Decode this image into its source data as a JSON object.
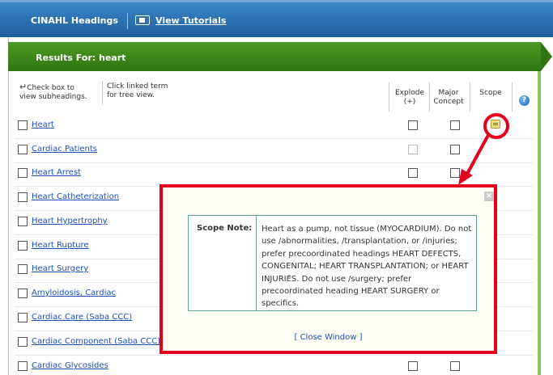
{
  "header": {
    "title": "CINAHL Headings",
    "tutorial_label": "View Tutorials"
  },
  "results": {
    "label": "Results For: heart"
  },
  "hints": {
    "checkbox_hint_line1": "Check box to",
    "checkbox_hint_line2": "view subheadings.",
    "tree_hint_line1": "Click linked term",
    "tree_hint_line2": "for tree view."
  },
  "columns": {
    "explode_line1": "Explode",
    "explode_line2": "(+)",
    "major_line1": "Major",
    "major_line2": "Concept",
    "scope": "Scope",
    "help": "?"
  },
  "terms": [
    {
      "label": "Heart",
      "explode": "enabled",
      "major": true,
      "scope": true
    },
    {
      "label": "Cardiac Patients",
      "explode": "disabled",
      "major": true,
      "scope": false
    },
    {
      "label": "Heart Arrest",
      "explode": "enabled",
      "major": true,
      "scope": false
    },
    {
      "label": "Heart Catheterization"
    },
    {
      "label": "Heart Hypertrophy"
    },
    {
      "label": "Heart Rupture"
    },
    {
      "label": "Heart Surgery"
    },
    {
      "label": "Amyloidosis, Cardiac"
    },
    {
      "label": "Cardiac Care (Saba CCC)"
    },
    {
      "label": "Cardiac Component (Saba CCC)"
    },
    {
      "label": "Cardiac Glycosides",
      "explode": "enabled",
      "major": true,
      "scope": false
    }
  ],
  "scope_popup": {
    "label": "Scope Note:",
    "text": "Heart as a pump, not tissue (MYOCARDIUM). Do not use /abnormalities, /transplantation, or /injuries; prefer precoordinated headings HEART DEFECTS, CONGENITAL; HEART TRANSPLANTATION; or HEART INJURIES. Do not use /surgery; prefer precoordinated heading HEART SURGERY or specifics.",
    "close_label": "[ Close Window ]",
    "close_x": "×"
  },
  "colors": {
    "header_blue": "#1f5f9e",
    "results_green": "#2f7410",
    "link_blue": "#1b4fb8",
    "highlight_red": "#e5001c"
  }
}
